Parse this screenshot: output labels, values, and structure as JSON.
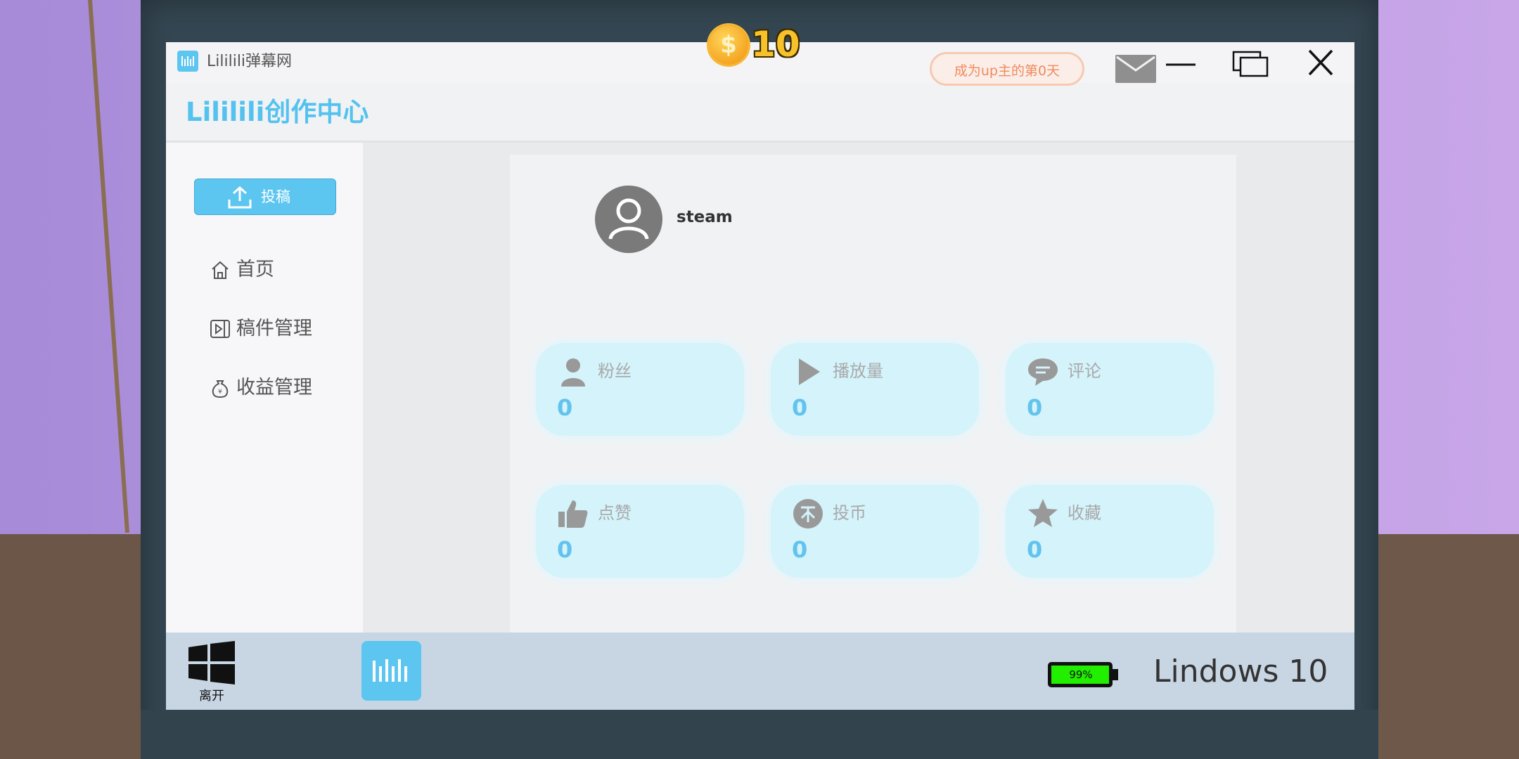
{
  "hud": {
    "coin_symbol": "$",
    "coins": "10"
  },
  "window": {
    "title": "Lililili弹幕网",
    "app_icon_text": "lililili"
  },
  "header": {
    "brand": "Lililili创作中心",
    "days_badge": "成为up主的第0天",
    "mail_icon": "mail-icon"
  },
  "sidebar": {
    "upload_label": "投稿",
    "items": [
      {
        "label": "首页",
        "icon": "home-icon"
      },
      {
        "label": "稿件管理",
        "icon": "video-file-icon"
      },
      {
        "label": "收益管理",
        "icon": "money-bag-icon"
      }
    ]
  },
  "profile": {
    "username": "steam",
    "avatar_icon": "user-avatar-icon"
  },
  "stats": [
    {
      "label": "粉丝",
      "value": "0",
      "icon": "person-icon"
    },
    {
      "label": "播放量",
      "value": "0",
      "icon": "play-icon"
    },
    {
      "label": "评论",
      "value": "0",
      "icon": "comment-icon"
    },
    {
      "label": "点赞",
      "value": "0",
      "icon": "thumbs-up-icon"
    },
    {
      "label": "投币",
      "value": "0",
      "icon": "coin-icon"
    },
    {
      "label": "收藏",
      "value": "0",
      "icon": "star-icon"
    }
  ],
  "taskbar": {
    "start_label": "离开",
    "app_icon_text": "lililili",
    "battery": "99%",
    "os_name": "Lindows 10"
  },
  "colors": {
    "accent": "#5cc6f0",
    "card_bg": "#d4f3fb",
    "battery_fill": "#22ee00",
    "badge_text": "#f08a5d"
  }
}
